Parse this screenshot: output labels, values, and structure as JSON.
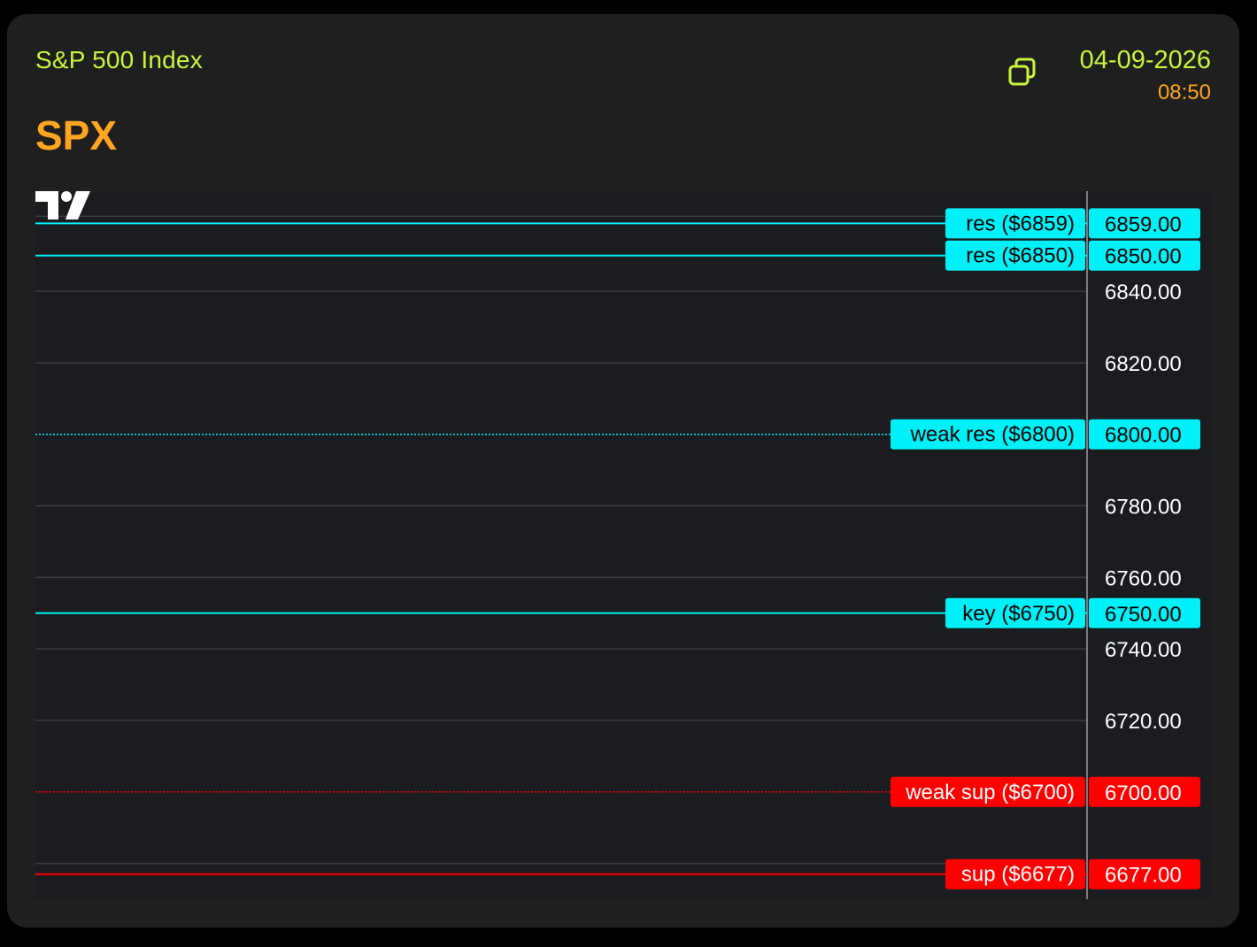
{
  "header": {
    "index_name": "S&P 500 Index",
    "ticker": "SPX",
    "date": "04-09-2026",
    "time": "08:50",
    "popout_icon": "popout-window-icon"
  },
  "colors": {
    "card_bg": "#1f1f1f",
    "chart_bg": "#1b1c20",
    "accent_green": "#c8f43c",
    "accent_orange": "#ffa51f",
    "resistance": "#00f0f8",
    "support": "#ff0000",
    "grid": "#3a3b40",
    "axis_text": "#ffffff"
  },
  "chart_data": {
    "type": "line",
    "y_axis": {
      "min": 6670,
      "max": 6868,
      "ticks": [
        6840,
        6820,
        6780,
        6760,
        6740,
        6720
      ],
      "tick_labels": [
        "6840.00",
        "6820.00",
        "6780.00",
        "6760.00",
        "6740.00",
        "6720.00"
      ]
    },
    "levels": [
      {
        "label": "res ($6859)",
        "price": 6859,
        "price_label": "6859.00",
        "kind": "res",
        "style": "solid"
      },
      {
        "label": "res ($6850)",
        "price": 6850,
        "price_label": "6850.00",
        "kind": "res",
        "style": "solid"
      },
      {
        "label": "weak res ($6800)",
        "price": 6800,
        "price_label": "6800.00",
        "kind": "res",
        "style": "dotted"
      },
      {
        "label": "key ($6750)",
        "price": 6750,
        "price_label": "6750.00",
        "kind": "res",
        "style": "solid"
      },
      {
        "label": "weak sup ($6700)",
        "price": 6700,
        "price_label": "6700.00",
        "kind": "sup",
        "style": "dotted"
      },
      {
        "label": "sup ($6677)",
        "price": 6677,
        "price_label": "6677.00",
        "kind": "sup",
        "style": "solid"
      }
    ]
  }
}
